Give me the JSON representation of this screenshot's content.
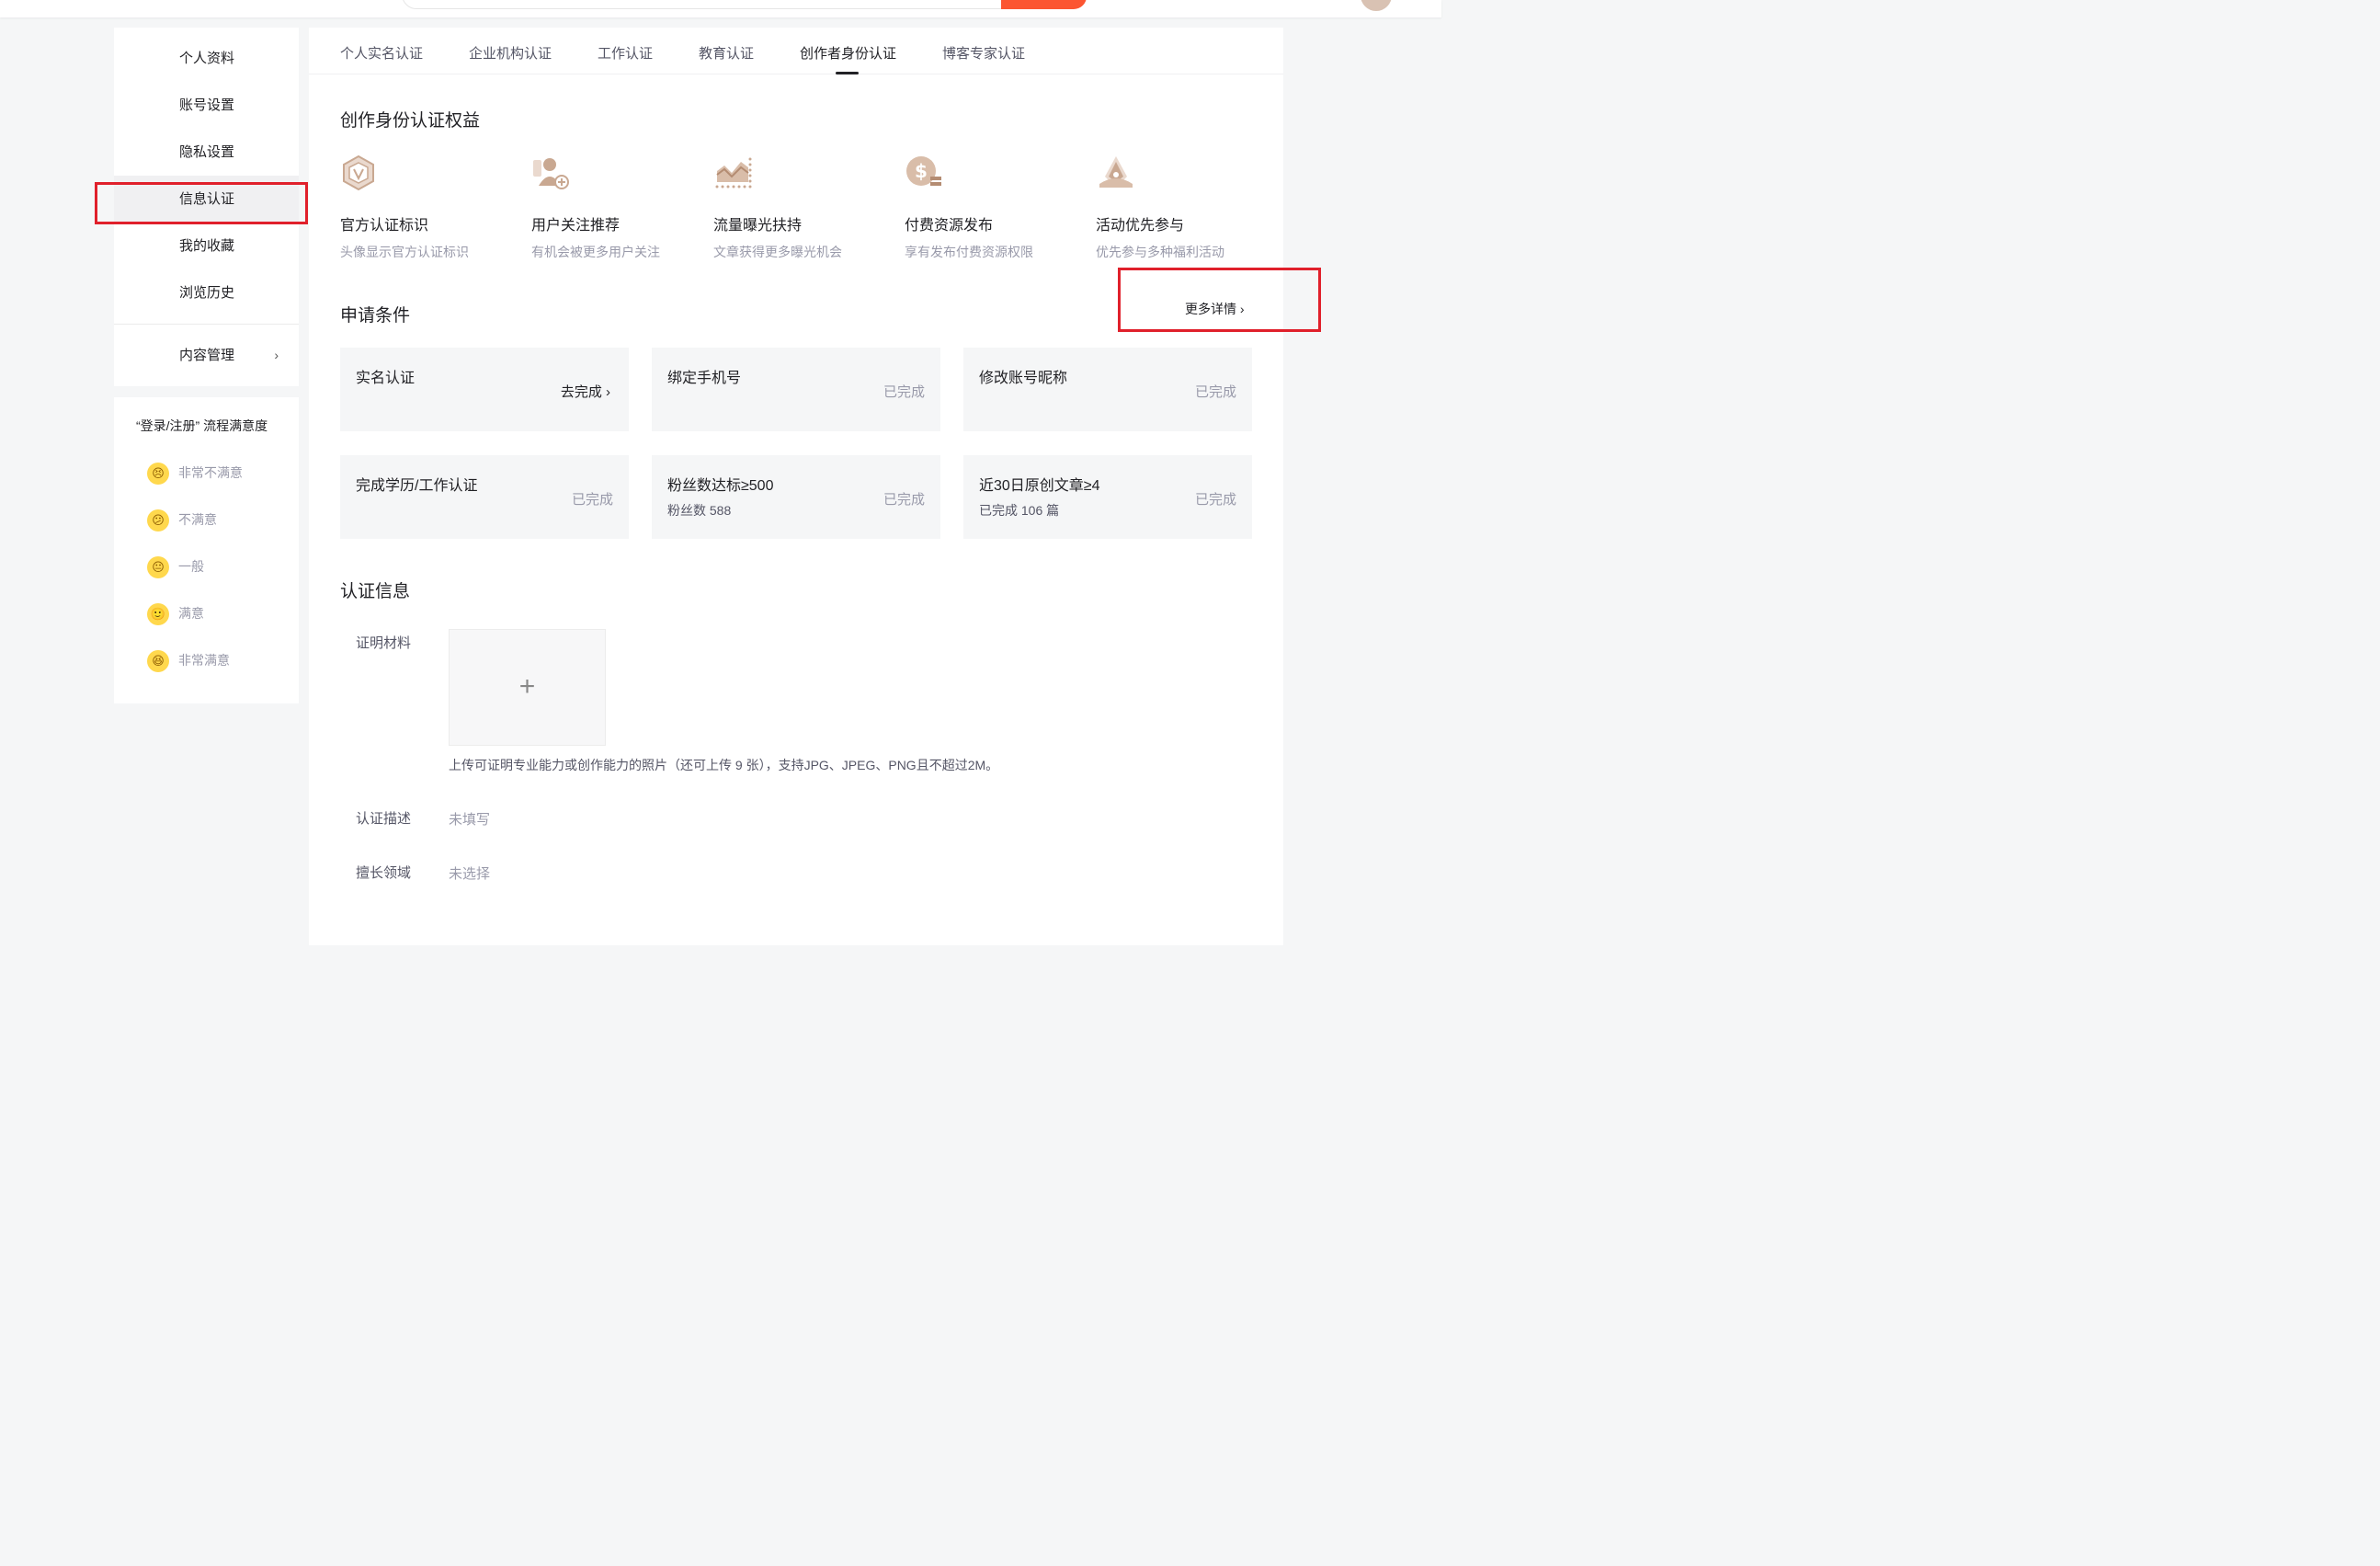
{
  "sidebar": {
    "items": [
      {
        "label": "个人资料"
      },
      {
        "label": "账号设置"
      },
      {
        "label": "隐私设置"
      },
      {
        "label": "信息认证"
      },
      {
        "label": "我的收藏"
      },
      {
        "label": "浏览历史"
      },
      {
        "label": "内容管理"
      }
    ],
    "active": "信息认证"
  },
  "survey": {
    "title": "“登录/注册” 流程满意度",
    "options": [
      {
        "label": "非常不满意",
        "emoji": "😣"
      },
      {
        "label": "不满意",
        "emoji": "😕"
      },
      {
        "label": "一般",
        "emoji": "😐"
      },
      {
        "label": "满意",
        "emoji": "🙂"
      },
      {
        "label": "非常满意",
        "emoji": "😆"
      }
    ]
  },
  "tabs": [
    {
      "label": "个人实名认证"
    },
    {
      "label": "企业机构认证"
    },
    {
      "label": "工作认证"
    },
    {
      "label": "教育认证"
    },
    {
      "label": "创作者身份认证"
    },
    {
      "label": "博客专家认证"
    }
  ],
  "active_tab": "创作者身份认证",
  "benefits": {
    "title": "创作身份认证权益",
    "items": [
      {
        "title": "官方认证标识",
        "desc": "头像显示官方认证标识",
        "icon": "verified-badge-icon"
      },
      {
        "title": "用户关注推荐",
        "desc": "有机会被更多用户关注",
        "icon": "user-recommend-icon"
      },
      {
        "title": "流量曝光扶持",
        "desc": "文章获得更多曝光机会",
        "icon": "traffic-chart-icon"
      },
      {
        "title": "付费资源发布",
        "desc": "享有发布付费资源权限",
        "icon": "paid-resource-icon"
      },
      {
        "title": "活动优先参与",
        "desc": "优先参与多种福利活动",
        "icon": "activity-priority-icon"
      }
    ]
  },
  "conditions": {
    "title": "申请条件",
    "more_label": "更多详情",
    "items": [
      {
        "title": "实名认证",
        "sub": "",
        "status": "",
        "action": "去完成"
      },
      {
        "title": "绑定手机号",
        "sub": "",
        "status": "已完成",
        "action": ""
      },
      {
        "title": "修改账号昵称",
        "sub": "",
        "status": "已完成",
        "action": ""
      },
      {
        "title": "完成学历/工作认证",
        "sub": "",
        "status": "已完成",
        "action": ""
      },
      {
        "title": "粉丝数达标≥500",
        "sub": "粉丝数 588",
        "status": "已完成",
        "action": ""
      },
      {
        "title": "近30日原创文章≥4",
        "sub": "已完成 106 篇",
        "status": "已完成",
        "action": ""
      }
    ]
  },
  "cert_info": {
    "title": "认证信息",
    "material_label": "证明材料",
    "upload_plus": "+",
    "upload_hint": "上传可证明专业能力或创作能力的照片（还可上传 9 张），支持JPG、JPEG、PNG且不超过2M。",
    "desc_label": "认证描述",
    "desc_value": "未填写",
    "field_label": "擅长领域",
    "field_value": "未选择"
  },
  "colors": {
    "accent": "#fc5531",
    "highlight": "#e0202b",
    "icon_tan": "#c9a891"
  }
}
